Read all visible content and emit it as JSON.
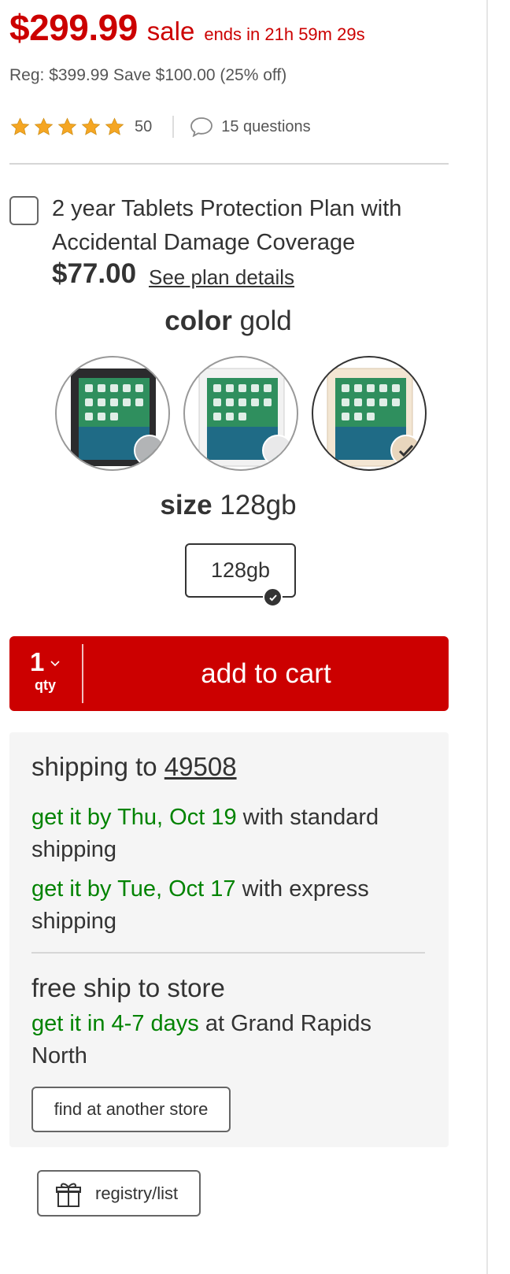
{
  "price": {
    "current": "$299.99",
    "sale_label": "sale",
    "countdown": "ends in 21h 59m 29s",
    "regular_line": "Reg: $399.99 Save $100.00 (25% off)"
  },
  "rating": {
    "stars": 5,
    "count": "50",
    "questions": "15 questions",
    "star_color": "#f5a623"
  },
  "protection_plan": {
    "label": "2 year Tablets Protection Plan with Accidental Damage Coverage",
    "price": "$77.00",
    "details_link": "See plan details",
    "checked": false
  },
  "color_picker": {
    "title": "color",
    "selected": "gold",
    "options": [
      {
        "name": "space gray",
        "swatch": "#b2b4b6",
        "selected": false
      },
      {
        "name": "silver",
        "swatch": "#e9e9ea",
        "selected": false
      },
      {
        "name": "gold",
        "swatch": "#e8d6bd",
        "selected": true
      }
    ]
  },
  "size_picker": {
    "title": "size",
    "selected": "128gb",
    "options": [
      "128gb"
    ]
  },
  "cart": {
    "qty_value": "1",
    "qty_label": "qty",
    "add_label": "add to cart",
    "color": "#cc0000"
  },
  "shipping": {
    "title_prefix": "shipping to",
    "zip": "49508",
    "standard_date": "get it by Thu, Oct 19",
    "standard_suffix": "with standard shipping",
    "express_date": "get it by Tue, Oct 17",
    "express_suffix": "with express shipping",
    "store_title": "free ship to store",
    "store_eta": "get it in 4-7 days",
    "store_suffix": "at Grand Rapids North",
    "find_store_label": "find at another store",
    "highlight_color": "#008300"
  },
  "registry": {
    "label": "registry/list",
    "icon": "gift-icon"
  }
}
